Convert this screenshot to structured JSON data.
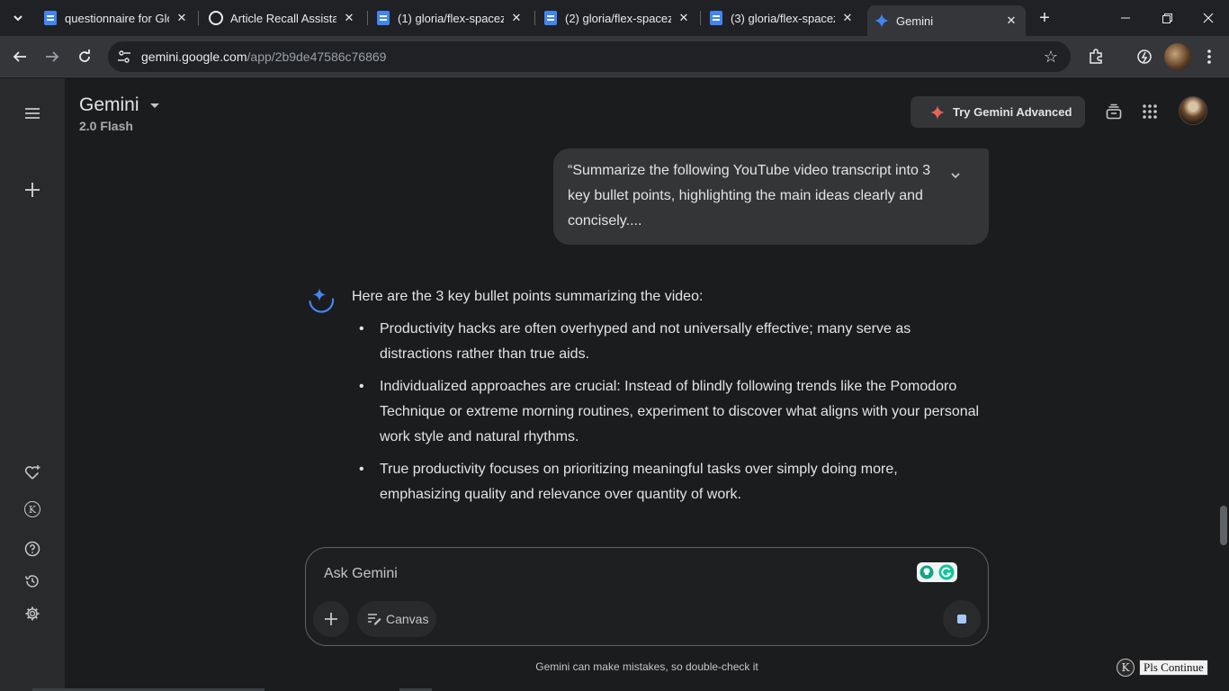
{
  "browser": {
    "tabs": [
      {
        "title": "questionnaire for Glo",
        "icon": "google-docs-icon"
      },
      {
        "title": "Article Recall Assistan",
        "icon": "chatgpt-icon"
      },
      {
        "title": "(1) gloria/flex-spacez",
        "icon": "google-docs-icon"
      },
      {
        "title": "(2) gloria/flex-spacez",
        "icon": "google-docs-icon"
      },
      {
        "title": "(3) gloria/flex-spacez",
        "icon": "google-docs-icon"
      },
      {
        "title": "Gemini",
        "icon": "gemini-icon",
        "active": true
      }
    ],
    "address": {
      "domain": "gemini.google.com",
      "path": "/app/2b9de47586c76869"
    }
  },
  "header": {
    "brand": "Gemini",
    "model": "2.0 Flash",
    "try_advanced": "Try Gemini Advanced"
  },
  "conversation": {
    "user_prompt": "“Summarize the following YouTube video transcript into 3 key bullet points, highlighting the main ideas clearly and concisely....",
    "response_intro": "Here are the 3 key bullet points summarizing the video:",
    "bullets": [
      "Productivity hacks are often overhyped and not universally effective; many serve as distractions rather than true aids.",
      "Individualized approaches are crucial: Instead of blindly following trends like the Pomodoro Technique or extreme morning routines, experiment to discover what aligns with your personal work style and natural rhythms.",
      "True productivity focuses on prioritizing meaningful tasks over simply doing more, emphasizing quality and relevance over quantity of work."
    ]
  },
  "composer": {
    "placeholder": "Ask Gemini",
    "canvas_label": "Canvas"
  },
  "footer": {
    "disclaimer": "Gemini can make mistakes, so double-check it",
    "extension_button": "Pls Continue",
    "extension_badge": "K"
  },
  "colors": {
    "background": "#1b1c1d",
    "sidebar": "#282a2c",
    "accent_blue": "#4285f4",
    "spark_red": "#e8645a"
  }
}
